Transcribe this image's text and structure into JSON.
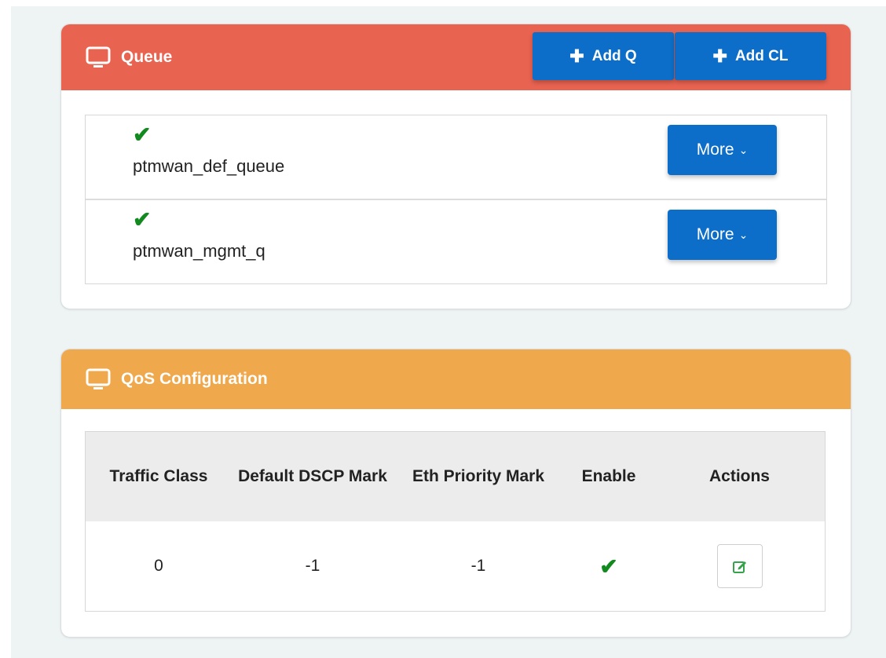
{
  "queue_panel": {
    "title": "Queue",
    "header_color": "#e96351",
    "add_q_label": "Add Q",
    "add_cl_label": "Add CL",
    "items": [
      {
        "name": "ptmwan_def_queue",
        "enabled": true,
        "more_label": "More"
      },
      {
        "name": "ptmwan_mgmt_q",
        "enabled": true,
        "more_label": "More"
      }
    ]
  },
  "qos_panel": {
    "title": "QoS Configuration",
    "header_color": "#f0a84c",
    "columns": [
      "Traffic Class",
      "Default DSCP Mark",
      "Eth Priority Mark",
      "Enable",
      "Actions"
    ],
    "rows": [
      {
        "traffic_class": "0",
        "default_dscp_mark": "-1",
        "eth_priority_mark": "-1",
        "enable": true
      }
    ]
  },
  "colors": {
    "primary_button": "#0c6ec8",
    "check": "#138a1f"
  }
}
